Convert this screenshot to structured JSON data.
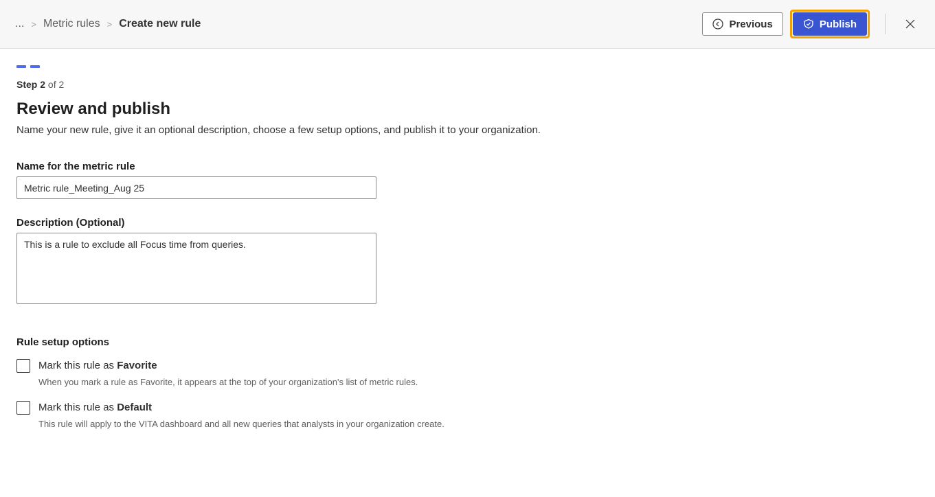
{
  "breadcrumb": {
    "ellipsis": "...",
    "parent": "Metric rules",
    "current": "Create new rule"
  },
  "header": {
    "previous_label": "Previous",
    "publish_label": "Publish"
  },
  "step": {
    "prefix": "Step 2",
    "suffix": "of 2"
  },
  "page": {
    "title": "Review and publish",
    "description": "Name your new rule, give it an optional description, choose a few setup options, and publish it to your organization."
  },
  "name_field": {
    "label": "Name for the metric rule",
    "value": "Metric rule_Meeting_Aug 25"
  },
  "desc_field": {
    "label": "Description (Optional)",
    "value": "This is a rule to exclude all Focus time from queries."
  },
  "options": {
    "section_label": "Rule setup options",
    "favorite": {
      "label_prefix": "Mark this rule as ",
      "label_bold": "Favorite",
      "desc": "When you mark a rule as Favorite, it appears at the top of your organization's list of metric rules."
    },
    "default": {
      "label_prefix": "Mark this rule as ",
      "label_bold": "Default",
      "desc": "This rule will apply to the VITA dashboard and all new queries that analysts in your organization create."
    }
  }
}
